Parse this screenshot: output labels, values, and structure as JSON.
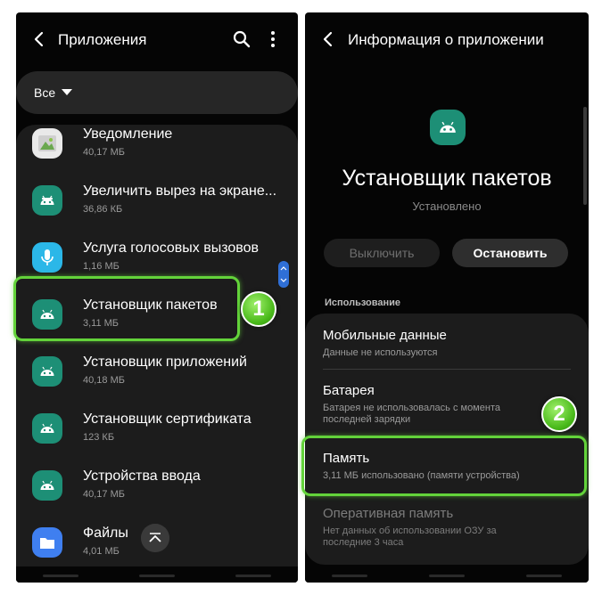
{
  "left_screen": {
    "header": {
      "title": "Приложения"
    },
    "filter": {
      "label": "Все"
    },
    "apps": [
      {
        "name": "Уведомление",
        "size": "40,17 МБ",
        "icon": "gallery"
      },
      {
        "name": "Увеличить вырез на экране...",
        "size": "36,86 КБ",
        "icon": "android"
      },
      {
        "name": "Услуга голосовых вызовов",
        "size": "1,16 МБ",
        "icon": "microphone"
      },
      {
        "name": "Установщик пакетов",
        "size": "3,11 МБ",
        "icon": "android"
      },
      {
        "name": "Установщик приложений",
        "size": "40,18 МБ",
        "icon": "android"
      },
      {
        "name": "Установщик сертификата",
        "size": "123 КБ",
        "icon": "android"
      },
      {
        "name": "Устройства ввода",
        "size": "40,17 МБ",
        "icon": "android"
      },
      {
        "name": "Файлы",
        "size": "4,01 МБ",
        "icon": "folder"
      }
    ],
    "badge": "1"
  },
  "right_screen": {
    "header": {
      "title": "Информация о приложении"
    },
    "app_name": "Установщик пакетов",
    "status": "Установлено",
    "buttons": {
      "disable": "Выключить",
      "stop": "Остановить"
    },
    "section": "Использование",
    "items": [
      {
        "title": "Мобильные данные",
        "subtitle": "Данные не используются"
      },
      {
        "title": "Батарея",
        "subtitle": "Батарея не использовалась с момента последней зарядки"
      },
      {
        "title": "Память",
        "subtitle": "3,11 МБ использовано (памяти устройства)"
      },
      {
        "title": "Оперативная память",
        "subtitle": "Нет данных об использовании ОЗУ за последние 3 часа"
      }
    ],
    "badge": "2"
  },
  "colors": {
    "highlight": "#63d33a",
    "android_icon": "#1d8f76",
    "scroll_thumb": "#2f6fd6"
  }
}
